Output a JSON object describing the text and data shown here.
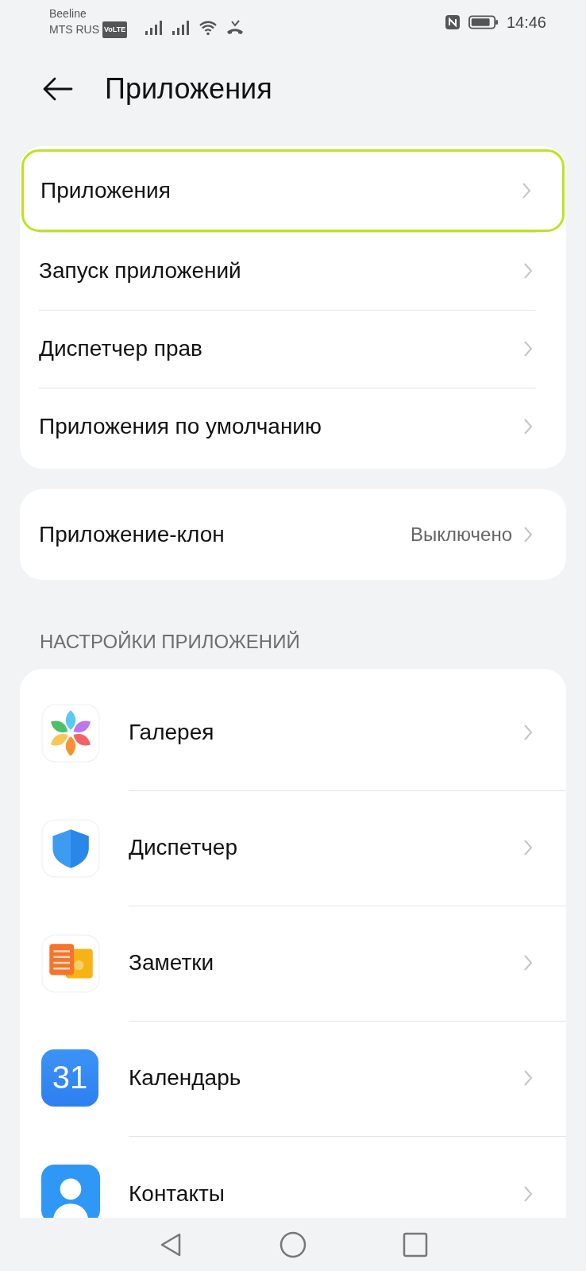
{
  "status_bar": {
    "carriers": [
      "Beeline",
      "MTS RUS"
    ],
    "volte": "VoLTE",
    "time": "14:46"
  },
  "header": {
    "title": "Приложения"
  },
  "groups": [
    {
      "items": [
        {
          "label": "Приложения",
          "highlighted": true
        },
        {
          "label": "Запуск приложений",
          "highlighted": false
        },
        {
          "label": "Диспетчер прав",
          "highlighted": false
        },
        {
          "label": "Приложения по умолчанию",
          "highlighted": false
        }
      ]
    },
    {
      "items": [
        {
          "label": "Приложение-клон",
          "value": "Выключено",
          "highlighted": false
        }
      ]
    }
  ],
  "app_settings": {
    "heading": "НАСТРОЙКИ ПРИЛОЖЕНИЙ",
    "apps": [
      {
        "name": "Галерея",
        "kind": "gallery"
      },
      {
        "name": "Диспетчер",
        "kind": "shield"
      },
      {
        "name": "Заметки",
        "kind": "notes"
      },
      {
        "name": "Календарь",
        "kind": "calendar",
        "icon_text": "31"
      },
      {
        "name": "Контакты",
        "kind": "contacts"
      }
    ]
  }
}
